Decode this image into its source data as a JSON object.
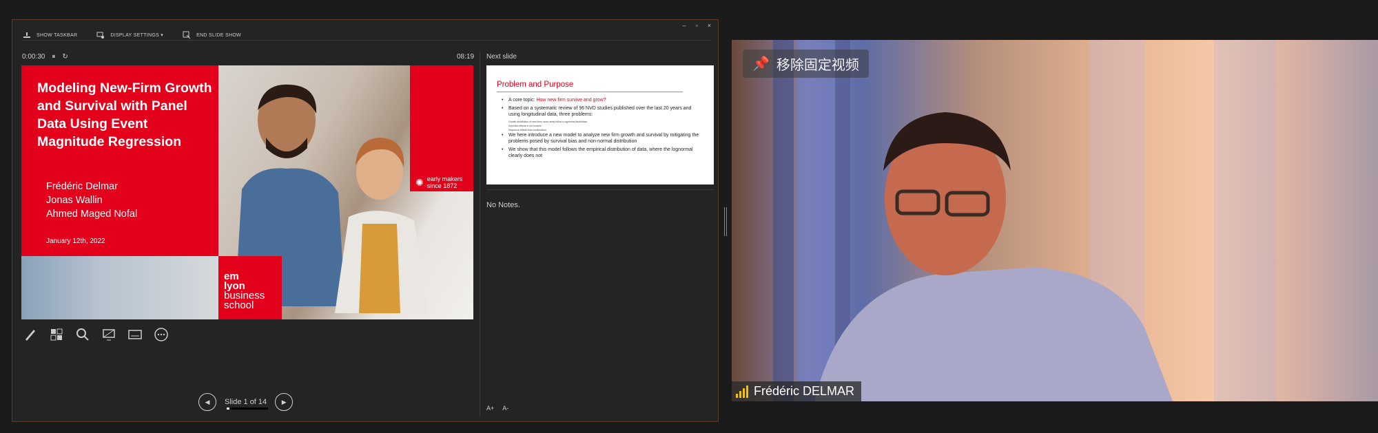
{
  "presenter": {
    "toolbar": {
      "show_taskbar": "SHOW TASKBAR",
      "display_settings": "DISPLAY SETTINGS ▾",
      "end_slide_show": "END SLIDE SHOW"
    },
    "window_controls": [
      "–",
      "▫",
      "×"
    ],
    "elapsed": "0:00:30",
    "clock": "08:19",
    "current_slide": {
      "title": "Modeling New-Firm Growth and Survival with Panel Data Using Event Magnitude Regression",
      "authors": [
        "Frédéric Delmar",
        "Jonas Wallin",
        "Ahmed Maged Nofal"
      ],
      "date": "January 12th, 2022",
      "logo_lines": [
        "em",
        "lyon",
        "business",
        "school"
      ],
      "tagline": [
        "early makers",
        "since 1872"
      ]
    },
    "next_label": "Next slide",
    "next_slide": {
      "title": "Problem and Purpose",
      "bullet1_prefix": "A core topic: ",
      "bullet1_highlight": "How new firm survive and grow?",
      "bullet2": "Based on a systematic review of 96 NVD studies published over the last 20 years and using longitudinal data, three problems:",
      "sub": [
        "Growth distribution of new firms does rarely follow a lognormal distribution",
        "Selection effects in our models",
        "Sequence effects from continuation"
      ],
      "bullet3": "We here introduce a new model to analyze new firm growth and survival by mitigating the problems posed by survival bias and non-normal distribution",
      "bullet4": "We show that this model follows the empirical distribution of data, where the lognormal clearly does not"
    },
    "notes": "No Notes.",
    "font_buttons": [
      "A+",
      "A-"
    ],
    "slide_counter": "Slide 1 of 14",
    "progress_fraction": 0.07
  },
  "video": {
    "pin_label": "移除固定视频",
    "participant_name": "Frédéric DELMAR"
  },
  "colors": {
    "brand_red": "#e2001a",
    "signal_yellow": "#f1c400"
  }
}
